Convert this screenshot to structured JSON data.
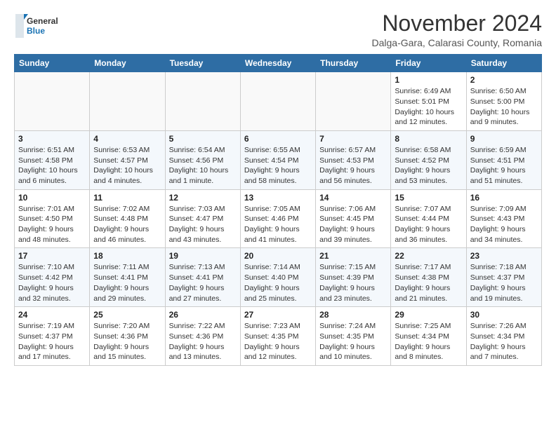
{
  "header": {
    "logo_general": "General",
    "logo_blue": "Blue",
    "month_title": "November 2024",
    "subtitle": "Dalga-Gara, Calarasi County, Romania"
  },
  "weekdays": [
    "Sunday",
    "Monday",
    "Tuesday",
    "Wednesday",
    "Thursday",
    "Friday",
    "Saturday"
  ],
  "weeks": [
    [
      {
        "day": "",
        "info": ""
      },
      {
        "day": "",
        "info": ""
      },
      {
        "day": "",
        "info": ""
      },
      {
        "day": "",
        "info": ""
      },
      {
        "day": "",
        "info": ""
      },
      {
        "day": "1",
        "info": "Sunrise: 6:49 AM\nSunset: 5:01 PM\nDaylight: 10 hours and 12 minutes."
      },
      {
        "day": "2",
        "info": "Sunrise: 6:50 AM\nSunset: 5:00 PM\nDaylight: 10 hours and 9 minutes."
      }
    ],
    [
      {
        "day": "3",
        "info": "Sunrise: 6:51 AM\nSunset: 4:58 PM\nDaylight: 10 hours and 6 minutes."
      },
      {
        "day": "4",
        "info": "Sunrise: 6:53 AM\nSunset: 4:57 PM\nDaylight: 10 hours and 4 minutes."
      },
      {
        "day": "5",
        "info": "Sunrise: 6:54 AM\nSunset: 4:56 PM\nDaylight: 10 hours and 1 minute."
      },
      {
        "day": "6",
        "info": "Sunrise: 6:55 AM\nSunset: 4:54 PM\nDaylight: 9 hours and 58 minutes."
      },
      {
        "day": "7",
        "info": "Sunrise: 6:57 AM\nSunset: 4:53 PM\nDaylight: 9 hours and 56 minutes."
      },
      {
        "day": "8",
        "info": "Sunrise: 6:58 AM\nSunset: 4:52 PM\nDaylight: 9 hours and 53 minutes."
      },
      {
        "day": "9",
        "info": "Sunrise: 6:59 AM\nSunset: 4:51 PM\nDaylight: 9 hours and 51 minutes."
      }
    ],
    [
      {
        "day": "10",
        "info": "Sunrise: 7:01 AM\nSunset: 4:50 PM\nDaylight: 9 hours and 48 minutes."
      },
      {
        "day": "11",
        "info": "Sunrise: 7:02 AM\nSunset: 4:48 PM\nDaylight: 9 hours and 46 minutes."
      },
      {
        "day": "12",
        "info": "Sunrise: 7:03 AM\nSunset: 4:47 PM\nDaylight: 9 hours and 43 minutes."
      },
      {
        "day": "13",
        "info": "Sunrise: 7:05 AM\nSunset: 4:46 PM\nDaylight: 9 hours and 41 minutes."
      },
      {
        "day": "14",
        "info": "Sunrise: 7:06 AM\nSunset: 4:45 PM\nDaylight: 9 hours and 39 minutes."
      },
      {
        "day": "15",
        "info": "Sunrise: 7:07 AM\nSunset: 4:44 PM\nDaylight: 9 hours and 36 minutes."
      },
      {
        "day": "16",
        "info": "Sunrise: 7:09 AM\nSunset: 4:43 PM\nDaylight: 9 hours and 34 minutes."
      }
    ],
    [
      {
        "day": "17",
        "info": "Sunrise: 7:10 AM\nSunset: 4:42 PM\nDaylight: 9 hours and 32 minutes."
      },
      {
        "day": "18",
        "info": "Sunrise: 7:11 AM\nSunset: 4:41 PM\nDaylight: 9 hours and 29 minutes."
      },
      {
        "day": "19",
        "info": "Sunrise: 7:13 AM\nSunset: 4:41 PM\nDaylight: 9 hours and 27 minutes."
      },
      {
        "day": "20",
        "info": "Sunrise: 7:14 AM\nSunset: 4:40 PM\nDaylight: 9 hours and 25 minutes."
      },
      {
        "day": "21",
        "info": "Sunrise: 7:15 AM\nSunset: 4:39 PM\nDaylight: 9 hours and 23 minutes."
      },
      {
        "day": "22",
        "info": "Sunrise: 7:17 AM\nSunset: 4:38 PM\nDaylight: 9 hours and 21 minutes."
      },
      {
        "day": "23",
        "info": "Sunrise: 7:18 AM\nSunset: 4:37 PM\nDaylight: 9 hours and 19 minutes."
      }
    ],
    [
      {
        "day": "24",
        "info": "Sunrise: 7:19 AM\nSunset: 4:37 PM\nDaylight: 9 hours and 17 minutes."
      },
      {
        "day": "25",
        "info": "Sunrise: 7:20 AM\nSunset: 4:36 PM\nDaylight: 9 hours and 15 minutes."
      },
      {
        "day": "26",
        "info": "Sunrise: 7:22 AM\nSunset: 4:36 PM\nDaylight: 9 hours and 13 minutes."
      },
      {
        "day": "27",
        "info": "Sunrise: 7:23 AM\nSunset: 4:35 PM\nDaylight: 9 hours and 12 minutes."
      },
      {
        "day": "28",
        "info": "Sunrise: 7:24 AM\nSunset: 4:35 PM\nDaylight: 9 hours and 10 minutes."
      },
      {
        "day": "29",
        "info": "Sunrise: 7:25 AM\nSunset: 4:34 PM\nDaylight: 9 hours and 8 minutes."
      },
      {
        "day": "30",
        "info": "Sunrise: 7:26 AM\nSunset: 4:34 PM\nDaylight: 9 hours and 7 minutes."
      }
    ]
  ]
}
